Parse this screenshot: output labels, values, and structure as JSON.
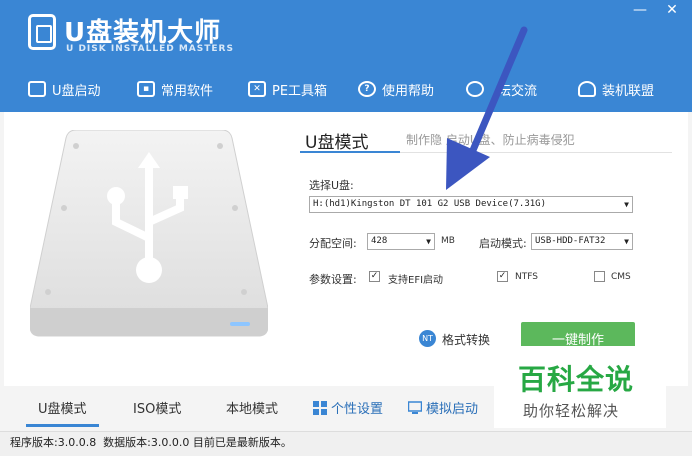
{
  "app": {
    "title": "U盘装机大师",
    "subtitle": "U DISK INSTALLED MASTERS"
  },
  "nav": [
    {
      "label": "U盘启动",
      "icon": "monitor-icon"
    },
    {
      "label": "常用软件",
      "icon": "apps-icon"
    },
    {
      "label": "PE工具箱",
      "icon": "toolbox-icon"
    },
    {
      "label": "使用帮助",
      "icon": "help-icon"
    },
    {
      "label": "坛交流",
      "icon": "chat-icon"
    },
    {
      "label": "装机联盟",
      "icon": "users-icon"
    }
  ],
  "mode": {
    "title": "U盘模式",
    "desc": "制作隐 启动U盘、防止病毒侵犯"
  },
  "form": {
    "select_disk_label": "选择U盘:",
    "disk_value": "H:(hd1)Kingston DT 101 G2 USB Device(7.31G)",
    "partition_label": "分配空间:",
    "partition_value": "428",
    "partition_unit": "MB",
    "boot_label": "启动模式:",
    "boot_value": "USB-HDD-FAT32",
    "params_label": "参数设置:",
    "efi_label": "支持EFI启动",
    "ntfs_label": "NTFS",
    "cms_label": "CMS"
  },
  "actions": {
    "convert_label": "格式转换",
    "convert_icon_text": "NT",
    "make_label": "一键制作"
  },
  "bottom_tabs": [
    {
      "label": "U盘模式",
      "active": true
    },
    {
      "label": "ISO模式",
      "active": false
    },
    {
      "label": "本地模式",
      "active": false
    },
    {
      "label": "个性设置",
      "icon": "grid-icon"
    },
    {
      "label": "模拟启动",
      "icon": "screen-icon"
    }
  ],
  "status": {
    "text": "程序版本:3.0.0.8  数据版本:3.0.0.0 目前已是最新版本。"
  },
  "watermark": {
    "title": "百科全说",
    "subtitle": "助你轻松解决"
  },
  "colors": {
    "primary": "#3a86d4",
    "button_green": "#5cb85c",
    "watermark_green": "#27a844",
    "arrow": "#3c56c0"
  }
}
